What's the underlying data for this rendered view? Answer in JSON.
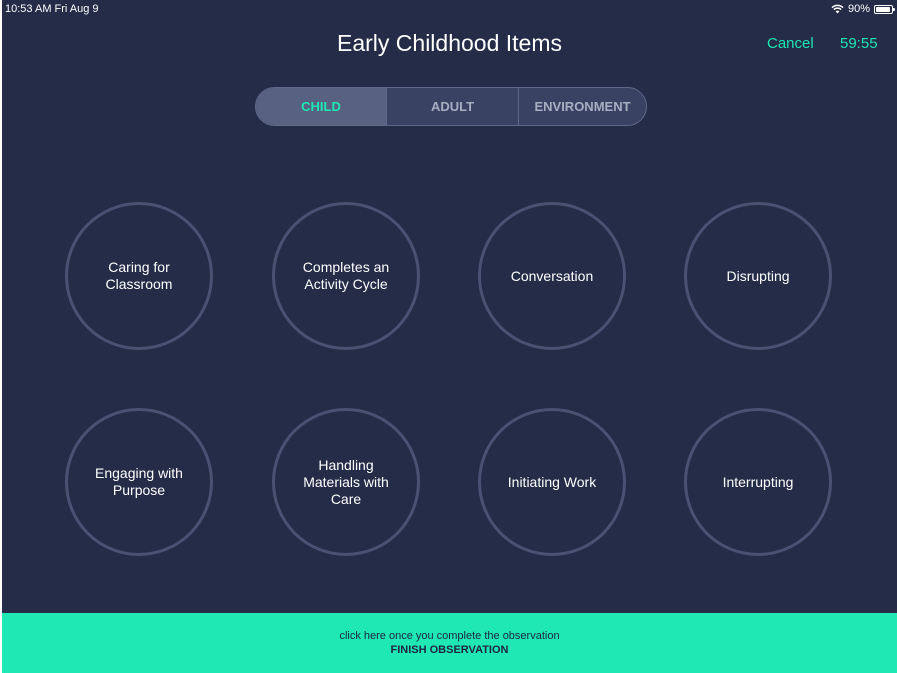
{
  "status_bar": {
    "time": "10:53 AM  Fri Aug 9",
    "battery": "90%",
    "battery_level": 0.9
  },
  "header": {
    "title": "Early Childhood Items",
    "cancel_label": "Cancel",
    "timer": "59:55"
  },
  "tabs": [
    {
      "label": "CHILD",
      "selected": true
    },
    {
      "label": "ADULT",
      "selected": false
    },
    {
      "label": "ENVIRONMENT",
      "selected": false
    }
  ],
  "items": [
    "Caring for Classroom",
    "Completes an Activity Cycle",
    "Conversation",
    "Disrupting",
    "Engaging with Purpose",
    "Handling Materials with Care",
    "Initiating Work",
    "Interrupting"
  ],
  "footer": {
    "hint": "click here once you complete the observation",
    "button_label": "FINISH OBSERVATION"
  },
  "colors": {
    "background": "#242c48",
    "accent": "#1ee6b4",
    "circle_border": "#4a5273"
  }
}
